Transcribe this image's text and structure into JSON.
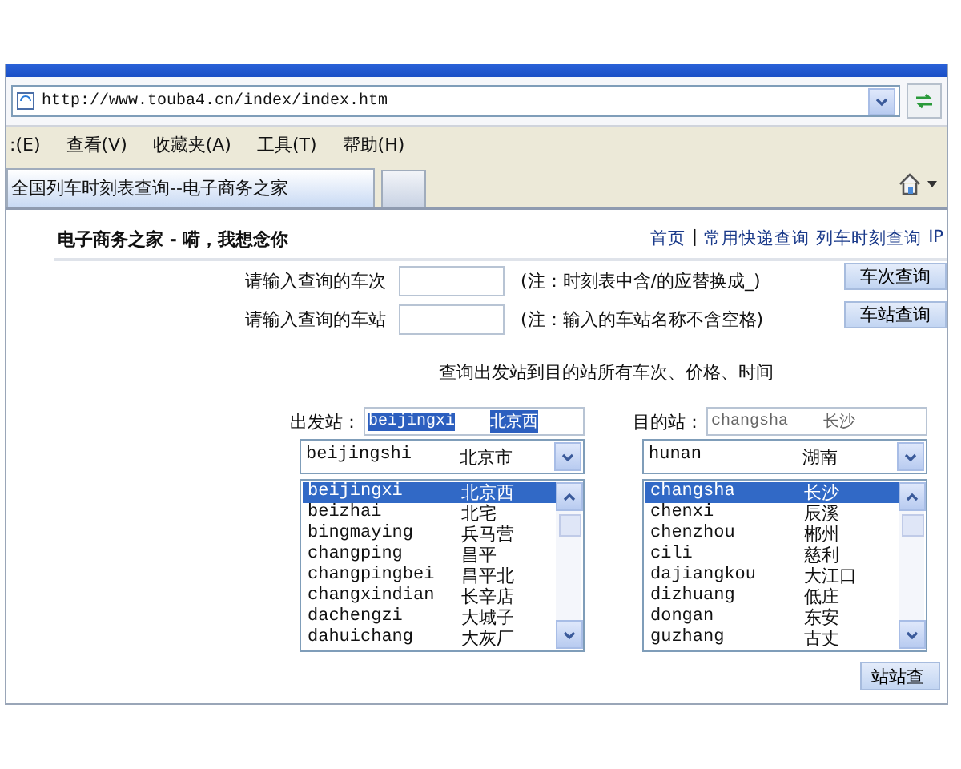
{
  "address_bar": {
    "url": "http://www.touba4.cn/index/index.htm"
  },
  "menu_bar": {
    "items": [
      ":(E)",
      "查看(V)",
      "收藏夹(A)",
      "工具(T)",
      "帮助(H)"
    ]
  },
  "tabs": [
    {
      "label": "全国列车时刻表查询--电子商务之家",
      "selected": true
    }
  ],
  "page": {
    "site_title": "电子商务之家 - 嗬，我想念你",
    "nav": [
      {
        "kind": "link",
        "text": "首页"
      },
      {
        "kind": "separator",
        "text": "|"
      },
      {
        "kind": "link",
        "text": "常用快递查询"
      },
      {
        "kind": "link",
        "text": "列车时刻查询"
      },
      {
        "kind": "link",
        "text": "IP"
      }
    ],
    "query_rows": [
      {
        "label": "请输入查询的车次",
        "note": "(注：时刻表中含/的应替换成_)",
        "button": "车次查询"
      },
      {
        "label": "请输入查询的车站",
        "note": "(注：输入的车站名称不含空格)",
        "button": "车站查询"
      }
    ],
    "route_heading": "查询出发站到目的站所有车次、价格、时间",
    "stations": [
      {
        "label": "出发站：",
        "value_pinyin": "beijingxi",
        "value_name": "北京西",
        "text_selected": true,
        "dropdown": {
          "pinyin": "beijingshi",
          "name": "北京市"
        },
        "options": [
          {
            "pinyin": "beijingxi",
            "name": "北京西",
            "selected": true
          },
          {
            "pinyin": "beizhai",
            "name": "北宅",
            "selected": false
          },
          {
            "pinyin": "bingmaying",
            "name": "兵马营",
            "selected": false
          },
          {
            "pinyin": "changping",
            "name": "昌平",
            "selected": false
          },
          {
            "pinyin": "changpingbei",
            "name": "昌平北",
            "selected": false
          },
          {
            "pinyin": "changxindian",
            "name": "长辛店",
            "selected": false
          },
          {
            "pinyin": "dachengzi",
            "name": "大城子",
            "selected": false
          },
          {
            "pinyin": "dahuichang",
            "name": "大灰厂",
            "selected": false
          }
        ]
      },
      {
        "label": "目的站：",
        "value_pinyin": "changsha",
        "value_name": "长沙",
        "text_selected": false,
        "dropdown": {
          "pinyin": "hunan",
          "name": "湖南"
        },
        "options": [
          {
            "pinyin": "changsha",
            "name": "长沙",
            "selected": true
          },
          {
            "pinyin": "chenxi",
            "name": "辰溪",
            "selected": false
          },
          {
            "pinyin": "chenzhou",
            "name": "郴州",
            "selected": false
          },
          {
            "pinyin": "cili",
            "name": "慈利",
            "selected": false
          },
          {
            "pinyin": "dajiangkou",
            "name": "大江口",
            "selected": false
          },
          {
            "pinyin": "dizhuang",
            "name": "低庄",
            "selected": false
          },
          {
            "pinyin": "dongan",
            "name": "东安",
            "selected": false
          },
          {
            "pinyin": "guzhang",
            "name": "古丈",
            "selected": false
          }
        ]
      }
    ],
    "route_button": "站站查"
  }
}
